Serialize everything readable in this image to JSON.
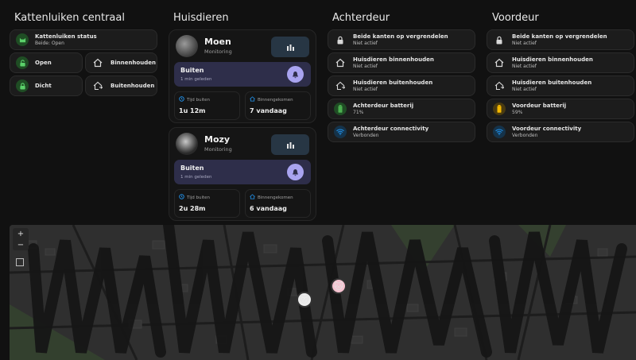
{
  "columns": {
    "central": {
      "title": "Kattenluiken centraal"
    },
    "pets": {
      "title": "Huisdieren"
    },
    "back": {
      "title": "Achterdeur"
    },
    "front": {
      "title": "Voordeur"
    }
  },
  "central": {
    "status": {
      "title": "Kattenluiken status",
      "value": "Beide: Open"
    },
    "buttons": {
      "open": "Open",
      "inside": "Binnenhouden",
      "closed": "Dicht",
      "outside": "Buitenhouden"
    }
  },
  "pets": [
    {
      "name": "Moen",
      "sub": "Monitoring",
      "status": "Buiten",
      "since": "1 min geleden",
      "time_label": "Tijd buiten",
      "time_value": "1u 12m",
      "entries_label": "Binnengekomen",
      "entries_value": "7 vandaag"
    },
    {
      "name": "Mozy",
      "sub": "Monitoring",
      "status": "Buiten",
      "since": "1 min geleden",
      "time_label": "Tijd buiten",
      "time_value": "2u 28m",
      "entries_label": "Binnengekomen",
      "entries_value": "6 vandaag"
    }
  ],
  "back": {
    "lock": {
      "title": "Beide kanten op vergrendelen",
      "value": "Niet actief"
    },
    "inside": {
      "title": "Huisdieren binnenhouden",
      "value": "Niet actief"
    },
    "outside": {
      "title": "Huisdieren buitenhouden",
      "value": "Niet actief"
    },
    "battery": {
      "title": "Achterdeur batterij",
      "value": "71%"
    },
    "conn": {
      "title": "Achterdeur connectivity",
      "value": "Verbonden"
    }
  },
  "front": {
    "lock": {
      "title": "Beide kanten op vergrendelen",
      "value": "Niet actief"
    },
    "inside": {
      "title": "Huisdieren binnenhouden",
      "value": "Niet actief"
    },
    "outside": {
      "title": "Huisdieren buitenhouden",
      "value": "Niet actief"
    },
    "battery": {
      "title": "Voordeur batterij",
      "value": "59%"
    },
    "conn": {
      "title": "Voordeur connectivity",
      "value": "Verbonden"
    }
  },
  "map": {
    "zoom_in": "+",
    "zoom_out": "−"
  },
  "colors": {
    "battery_back": "#4caf50",
    "battery_front": "#f5b800",
    "wifi": "#2196f3",
    "accent": "#a9a4f0"
  }
}
